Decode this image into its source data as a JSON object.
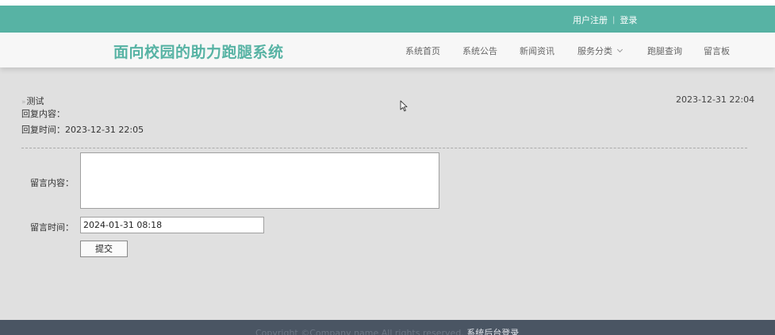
{
  "topbar": {
    "register": "用户注册",
    "separator": "|",
    "login": "登录"
  },
  "header": {
    "logo": "面向校园的助力跑腿系统"
  },
  "nav": {
    "items": [
      {
        "label": "系统首页"
      },
      {
        "label": "系统公告"
      },
      {
        "label": "新闻资讯"
      },
      {
        "label": "服务分类",
        "has_dropdown": true
      },
      {
        "label": "跑腿查询"
      },
      {
        "label": "留言板"
      }
    ]
  },
  "message": {
    "title_prefix": "»",
    "title": "测试",
    "date": "2023-12-31 22:04",
    "reply_label": "回复内容：",
    "reply_time": "回复时间：2023-12-31 22:05"
  },
  "form": {
    "content_label": "留言内容：",
    "content_value": "",
    "time_label": "留言时间：",
    "time_value": "2024-01-31 08:18",
    "submit_label": "提交"
  },
  "footer": {
    "copyright": "Copyright ©Company name All rights reserved.",
    "admin_link": "系统后台登录"
  },
  "colors": {
    "accent": "#57b3a4",
    "footer_bg": "#4a5563",
    "body_bg": "#e0e0e0"
  }
}
